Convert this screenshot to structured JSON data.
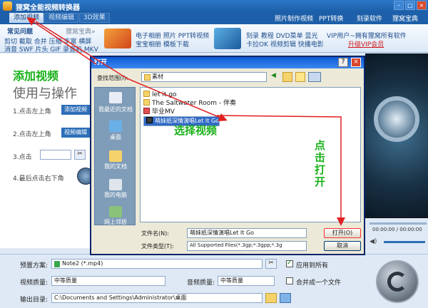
{
  "app": {
    "title": "狸窝全能视频转换器"
  },
  "toolbar": {
    "buttons": [
      {
        "label": "添加视频",
        "active": true
      },
      {
        "label": "视频编辑",
        "active": false
      },
      {
        "label": "3D效果",
        "active": false
      }
    ],
    "links": [
      "照片制作视频",
      "PPT转换",
      "刻录软件",
      "狸窝宝典"
    ]
  },
  "banner": {
    "tab_active": "常见问题",
    "tab_other": "狸窝宝典»",
    "left_links_row1": "剪切 截取 合并 压缩 丰富 横屏",
    "left_links_row2": "消音 SWF 片头 GIF 录音机 MKV",
    "mid1_row1": "电子相册 照片 PPT转视频",
    "mid1_row2": "宝宝相册 模板下载",
    "mid2_row1": "刻录 教程 DVD菜单 蓝光",
    "mid2_row2": "卡拉OK 视频剪辑 快播电影",
    "vip_row1": "VIP用户~拥有狸窝所有软件",
    "vip_row2": "升级VIP会员"
  },
  "left_panel": {
    "heading": "使用与操作",
    "step1_prefix": "1.点击左上角",
    "step1_btn": "添加视频",
    "step2_prefix": "2.点击左上角",
    "step2_btn": "视频编辑",
    "step3_prefix": "3.点击",
    "step4_prefix": "4.最后点击右下角"
  },
  "dialog": {
    "title": "打开",
    "help": "?",
    "close": "×",
    "look_in_label": "查找范围(I):",
    "look_in_value": "素材",
    "places": [
      "我最近的文档",
      "桌面",
      "我的文档",
      "我的电脑",
      "网上邻居"
    ],
    "files": [
      {
        "name": "let it go",
        "selected": false
      },
      {
        "name": "The Saltwater Room - 伴奏",
        "selected": false
      },
      {
        "name": "毕业MV",
        "selected": false
      },
      {
        "name": "萌妹纸深情演唱Let It Go",
        "selected": true
      }
    ],
    "filename_label": "文件名(N):",
    "filename_value": "萌妹纸深情演唱Let It Go",
    "filetype_label": "文件类型(T):",
    "filetype_value": "All Supported Files(*.3gp;*.3gpp;*.3g",
    "open_button": "打开(O)",
    "cancel_button": "取消"
  },
  "preview": {
    "time": "00:00:00 / 00:00:00"
  },
  "bottom": {
    "preset_label": "预置方案:",
    "preset_value": "Note2 (*.mp4)",
    "apply_all_label": "应用到所有",
    "apply_all_checked": true,
    "video_quality_label": "视频质量:",
    "video_quality_value": "中等质量",
    "audio_quality_label": "音频质量:",
    "audio_quality_value": "中等质量",
    "merge_label": "合并成一个文件",
    "merge_checked": false,
    "output_label": "输出目录:",
    "output_value": "C:\\Documents and Settings\\Administrator\\桌面"
  },
  "annotations": {
    "add_video": "添加视频",
    "select_video": "选择视频",
    "click_open": "点击打开"
  },
  "colors": {
    "accent": "#1d5fa8",
    "annotation": "#19b119",
    "arrow": "#e02020",
    "selection": "#316ac5"
  }
}
